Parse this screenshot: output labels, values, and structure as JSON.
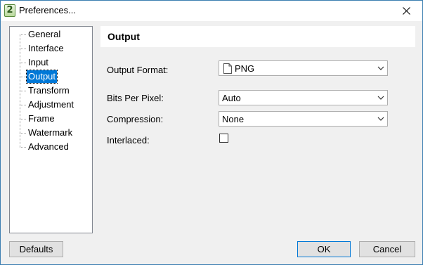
{
  "window": {
    "title": "Preferences...",
    "app_icon_glyph": "2"
  },
  "sidebar": {
    "items": [
      {
        "label": "General"
      },
      {
        "label": "Interface"
      },
      {
        "label": "Input"
      },
      {
        "label": "Output",
        "selected": true
      },
      {
        "label": "Transform"
      },
      {
        "label": "Adjustment"
      },
      {
        "label": "Frame"
      },
      {
        "label": "Watermark"
      },
      {
        "label": "Advanced"
      }
    ]
  },
  "panel": {
    "title": "Output",
    "fields": {
      "output_format": {
        "label": "Output Format:",
        "value": "PNG",
        "icon": "file-icon"
      },
      "bits_per_pixel": {
        "label": "Bits Per Pixel:",
        "value": "Auto"
      },
      "compression": {
        "label": "Compression:",
        "value": "None"
      },
      "interlaced": {
        "label": "Interlaced:",
        "checked": false
      }
    }
  },
  "buttons": {
    "defaults": "Defaults",
    "ok": "OK",
    "cancel": "Cancel"
  },
  "colors": {
    "selection": "#0078d7",
    "window_border": "#3c7fb1",
    "background": "#f0f0f0"
  }
}
